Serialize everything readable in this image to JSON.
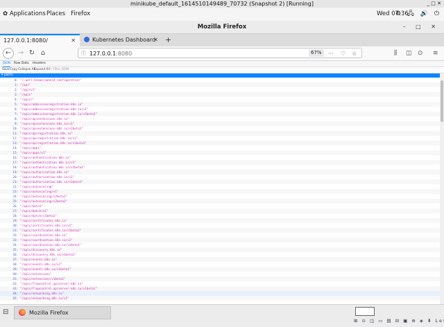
{
  "vm_window": {
    "title": "minikube_default_1614510149489_70732 (Snapshot 2) [Running]",
    "controls": "_ □ ✕"
  },
  "top_bar": {
    "menus": [
      "Applications",
      "Places",
      "Firefox"
    ],
    "clock": "Wed 07:36",
    "system_icons": "⚙ 🖧 🔊 ⏻"
  },
  "browser": {
    "window_title": "Mozilla Firefox",
    "window_buttons": "–  □  ✕",
    "tabs": [
      {
        "label": "127.0.0.1:8080/",
        "close": "✕"
      },
      {
        "label": "Kubernetes Dashboard",
        "close": "✕"
      }
    ],
    "new_tab": "+",
    "url_host": "127.0.0.1",
    "url_port": ":8080",
    "zoom": "67%",
    "url_actions": [
      "···",
      "♡",
      "☆"
    ],
    "toolbar_icons": [
      "⫼",
      "◫",
      "⊙",
      "≡"
    ]
  },
  "json_viewer": {
    "tabs": [
      "JSON",
      "Raw Data",
      "Headers"
    ],
    "toolbar": [
      "Save",
      "Copy",
      "Collapse All",
      "Expand All"
    ],
    "filter_placeholder": "▽ Filter JSON",
    "root_key": "▾ paths:",
    "rows": [
      {
        "k": "0:",
        "v": "\"/.well-known/openid-configuration\""
      },
      {
        "k": "1:",
        "v": "\"/api\""
      },
      {
        "k": "2:",
        "v": "\"/api/v1\""
      },
      {
        "k": "3:",
        "v": "\"/apis\""
      },
      {
        "k": "4:",
        "v": "\"/apis/\""
      },
      {
        "k": "5:",
        "v": "\"/apis/admissionregistration.k8s.io\""
      },
      {
        "k": "6:",
        "v": "\"/apis/admissionregistration.k8s.io/v1\""
      },
      {
        "k": "7:",
        "v": "\"/apis/admissionregistration.k8s.io/v1beta1\""
      },
      {
        "k": "8:",
        "v": "\"/apis/apiextensions.k8s.io\""
      },
      {
        "k": "9:",
        "v": "\"/apis/apiextensions.k8s.io/v1\""
      },
      {
        "k": "10:",
        "v": "\"/apis/apiextensions.k8s.io/v1beta1\""
      },
      {
        "k": "11:",
        "v": "\"/apis/apiregistration.k8s.io\""
      },
      {
        "k": "12:",
        "v": "\"/apis/apiregistration.k8s.io/v1\""
      },
      {
        "k": "13:",
        "v": "\"/apis/apiregistration.k8s.io/v1beta1\""
      },
      {
        "k": "14:",
        "v": "\"/apis/apps\""
      },
      {
        "k": "15:",
        "v": "\"/apis/apps/v1\""
      },
      {
        "k": "16:",
        "v": "\"/apis/authentication.k8s.io\""
      },
      {
        "k": "17:",
        "v": "\"/apis/authentication.k8s.io/v1\""
      },
      {
        "k": "18:",
        "v": "\"/apis/authentication.k8s.io/v1beta1\""
      },
      {
        "k": "19:",
        "v": "\"/apis/authorization.k8s.io\""
      },
      {
        "k": "20:",
        "v": "\"/apis/authorization.k8s.io/v1\""
      },
      {
        "k": "21:",
        "v": "\"/apis/authorization.k8s.io/v1beta1\""
      },
      {
        "k": "22:",
        "v": "\"/apis/autoscaling\""
      },
      {
        "k": "23:",
        "v": "\"/apis/autoscaling/v1\""
      },
      {
        "k": "24:",
        "v": "\"/apis/autoscaling/v2beta1\""
      },
      {
        "k": "25:",
        "v": "\"/apis/autoscaling/v2beta2\""
      },
      {
        "k": "26:",
        "v": "\"/apis/batch\""
      },
      {
        "k": "27:",
        "v": "\"/apis/batch/v1\""
      },
      {
        "k": "28:",
        "v": "\"/apis/batch/v1beta1\""
      },
      {
        "k": "29:",
        "v": "\"/apis/certificates.k8s.io\""
      },
      {
        "k": "30:",
        "v": "\"/apis/certificates.k8s.io/v1\""
      },
      {
        "k": "31:",
        "v": "\"/apis/certificates.k8s.io/v1beta1\""
      },
      {
        "k": "32:",
        "v": "\"/apis/coordination.k8s.io\""
      },
      {
        "k": "33:",
        "v": "\"/apis/coordination.k8s.io/v1\""
      },
      {
        "k": "34:",
        "v": "\"/apis/coordination.k8s.io/v1beta1\""
      },
      {
        "k": "35:",
        "v": "\"/apis/discovery.k8s.io\""
      },
      {
        "k": "36:",
        "v": "\"/apis/discovery.k8s.io/v1beta1\""
      },
      {
        "k": "37:",
        "v": "\"/apis/events.k8s.io\""
      },
      {
        "k": "38:",
        "v": "\"/apis/events.k8s.io/v1\""
      },
      {
        "k": "39:",
        "v": "\"/apis/events.k8s.io/v1beta1\""
      },
      {
        "k": "40:",
        "v": "\"/apis/extensions\""
      },
      {
        "k": "41:",
        "v": "\"/apis/extensions/v1beta1\""
      },
      {
        "k": "42:",
        "v": "\"/apis/flowcontrol.apiserver.k8s.io\""
      },
      {
        "k": "43:",
        "v": "\"/apis/flowcontrol.apiserver.k8s.io/v1beta1\""
      },
      {
        "k": "44:",
        "v": "\"/apis/networking.k8s.io\""
      },
      {
        "k": "45:",
        "v": "\"/apis/networking.k8s.io/v1\""
      }
    ],
    "highlighted_row": 44
  },
  "taskbar": {
    "task_label": "Mozilla Firefox",
    "tray_text": "⊞ ⊙ ◫ ▭ ▤ ⊟ ▣ ⊕ ◈ ⬇ Left ⌘"
  },
  "colors": {
    "accent": "#0a84ff",
    "json_key": "#4a5dc9",
    "json_string": "#d12cb0"
  }
}
